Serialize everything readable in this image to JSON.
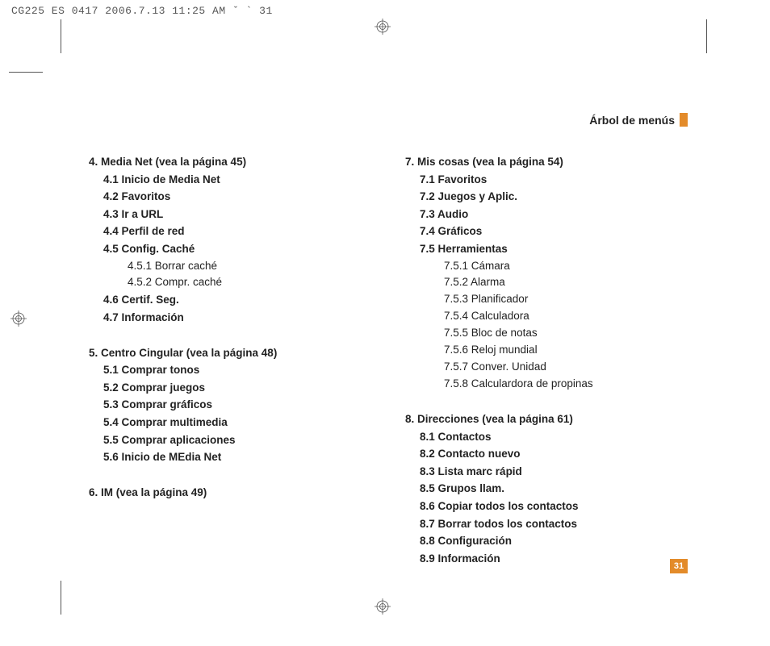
{
  "print_header": "CG225 ES 0417  2006.7.13 11:25 AM  ˇ ` 31",
  "page_title": "Árbol de menús",
  "page_number": "31",
  "left": {
    "s4": {
      "title": "4.  Media Net (vea la página 45)",
      "items": [
        "4.1 Inicio de Media Net",
        "4.2 Favoritos",
        "4.3 Ir a URL",
        "4.4 Perfil de red",
        "4.5 Config. Caché"
      ],
      "sub45": [
        "4.5.1 Borrar caché",
        "4.5.2 Compr. caché"
      ],
      "items2": [
        "4.6 Certif. Seg.",
        "4.7 Información"
      ]
    },
    "s5": {
      "title": "5.  Centro Cingular (vea la página 48)",
      "items": [
        "5.1 Comprar tonos",
        "5.2 Comprar juegos",
        "5.3 Comprar gráficos",
        "5.4 Comprar multimedia",
        "5.5 Comprar aplicaciones",
        "5.6 Inicio de MEdia Net"
      ]
    },
    "s6": {
      "title": "6.  IM (vea la página 49)"
    }
  },
  "right": {
    "s7": {
      "title": "7.  Mis cosas (vea la página 54)",
      "items": [
        "7.1 Favoritos",
        "7.2 Juegos y Aplic.",
        "7.3 Audio",
        "7.4 Gráficos",
        "7.5 Herramientas"
      ],
      "sub75": [
        "7.5.1 Cámara",
        "7.5.2 Alarma",
        "7.5.3 Planificador",
        "7.5.4 Calculadora",
        "7.5.5 Bloc de notas",
        "7.5.6 Reloj mundial",
        "7.5.7 Conver. Unidad",
        "7.5.8 Calculardora de propinas"
      ]
    },
    "s8": {
      "title": "8.  Direcciones (vea la página 61)",
      "items": [
        "8.1 Contactos",
        "8.2 Contacto nuevo",
        "8.3 Lista marc rápid",
        "8.5 Grupos llam.",
        "8.6 Copiar todos los contactos",
        "8.7 Borrar todos los contactos",
        "8.8 Configuración",
        "8.9 Información"
      ]
    }
  }
}
